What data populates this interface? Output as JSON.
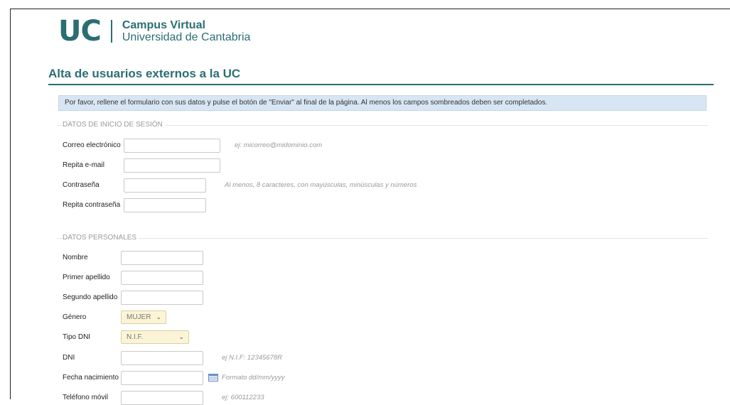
{
  "header": {
    "logo_mark": "UC",
    "logo_line1": "Campus Virtual",
    "logo_line2": "Universidad de Cantabria"
  },
  "page_title": "Alta de usuarios externos a la UC",
  "info_message": "Por favor, rellene el formulario con sus datos y pulse el botón de \"Enviar\" al final de la página. Al menos los campos sombreados deben ser completados.",
  "login_section": {
    "title": "DATOS DE INICIO DE SESIÓN",
    "fields": [
      {
        "label": "Correo electrónico",
        "value": "",
        "hint": "ej: micorreo@midominio.com"
      },
      {
        "label": "Repita e-mail",
        "value": "",
        "hint": ""
      },
      {
        "label": "Contraseña",
        "value": "",
        "hint": "Al menos, 8 caracteres, con mayúsculas, minúsculas y números"
      },
      {
        "label": "Repita contraseña",
        "value": "",
        "hint": ""
      }
    ]
  },
  "personal_section": {
    "title": "DATOS PERSONALES",
    "fields": [
      {
        "label": "Nombre",
        "value": "",
        "hint": ""
      },
      {
        "label": "Primer apellido",
        "value": "",
        "hint": ""
      },
      {
        "label": "Segundo apellido",
        "value": "",
        "hint": ""
      },
      {
        "label": "Género",
        "selected": "MUJER"
      },
      {
        "label": "Tipo DNI",
        "selected": "N.I.F."
      },
      {
        "label": "DNI",
        "value": "",
        "hint": "ej N.I.F: 12345678R"
      },
      {
        "label": "Fecha nacimiento",
        "value": "",
        "hint": "Formato dd/mm/yyyy"
      },
      {
        "label": "Teléfono móvil",
        "value": "",
        "hint": "ej: 600112233"
      }
    ]
  },
  "icons": {
    "calendar": "calendar-icon",
    "chevron": "chevron-down-icon"
  },
  "colors": {
    "brand": "#2b6e72",
    "info_bg": "#d8e6f3",
    "select_bg": "#fcf4d6"
  }
}
